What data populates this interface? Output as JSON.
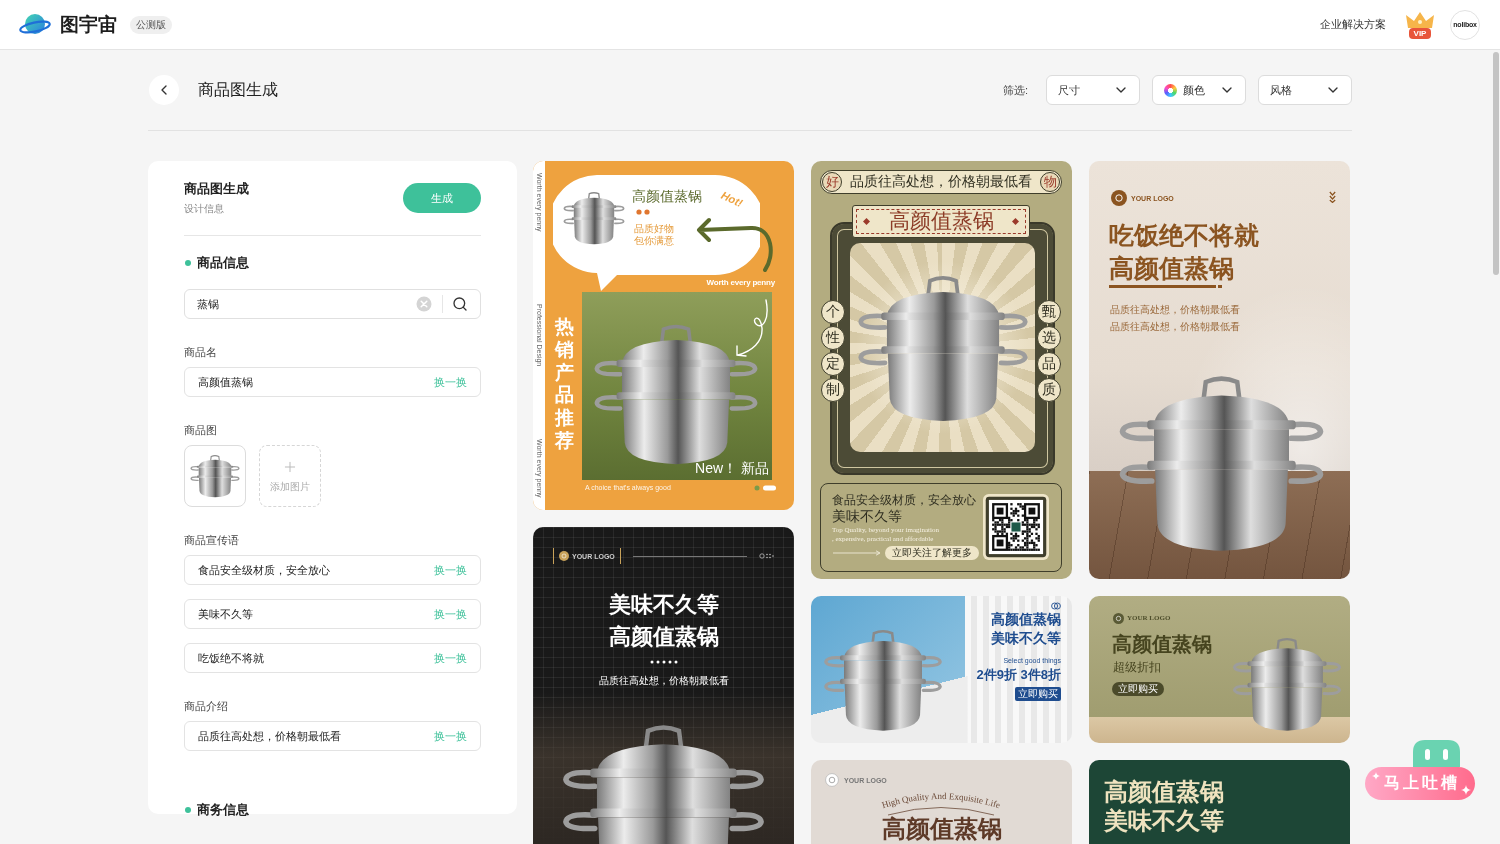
{
  "header": {
    "logo": "图宇宙",
    "badge": "公测版",
    "link": "企业解决方案",
    "vip": "VIP",
    "avatar": "nolibox"
  },
  "toolbar": {
    "title": "商品图生成",
    "filter_label": "筛选:",
    "filters": [
      {
        "kind": "plain",
        "label": "尺寸"
      },
      {
        "kind": "color",
        "label": "颜色"
      },
      {
        "kind": "plain",
        "label": "风格"
      }
    ]
  },
  "form": {
    "title": "商品图生成",
    "subtitle": "设计信息",
    "button": "生成",
    "sections": [
      {
        "title": "商品信息",
        "search": {
          "value": "蒸锅"
        },
        "groups": [
          {
            "kind": "text",
            "label": "商品名",
            "fields": [
              {
                "value": "高颜值蒸锅",
                "action": "换一换"
              }
            ]
          },
          {
            "kind": "images",
            "label": "商品图",
            "add_label": "添加图片"
          },
          {
            "kind": "text",
            "label": "商品宣传语",
            "fields": [
              {
                "value": "食品安全级材质，安全放心",
                "action": "换一换"
              },
              {
                "value": "美味不久等",
                "action": "换一换"
              },
              {
                "value": "吃饭绝不将就",
                "action": "换一换"
              }
            ]
          },
          {
            "kind": "text",
            "label": "商品介绍",
            "fields": [
              {
                "value": "品质往高处想，价格朝最低看",
                "action": "换一换"
              }
            ]
          }
        ]
      },
      {
        "title": "商务信息"
      }
    ]
  },
  "templates": {
    "columns": [
      [
        {
          "kind": "hot_sale",
          "side_texts": [
            "Worth every penny",
            "Professional Design",
            "Worth every penny"
          ],
          "title": "高颜值蒸锅",
          "hot": "Hot!",
          "tagline": [
            "品质好物",
            "包你满意"
          ],
          "slogan": "Worth every penny",
          "vertical_title": "热销产品推荐",
          "badge": "New！ 新品",
          "caption": "A choice that's always good"
        },
        {
          "kind": "dark_kitchen",
          "logo": "YOUR LOGO",
          "headline": [
            "美味不久等",
            "高颜值蒸锅"
          ],
          "subtitle": "品质往高处想，价格朝最低看"
        }
      ],
      [
        {
          "kind": "retro",
          "seals": [
            "好",
            "物"
          ],
          "banner": "品质往高处想，价格朝最低看",
          "title": "高颜值蒸锅",
          "left_badges": [
            "个",
            "性",
            "定",
            "制"
          ],
          "right_badges": [
            "甄",
            "选",
            "品",
            "质"
          ],
          "lines": [
            "食品安全级材质，安全放心",
            "美味不久等"
          ],
          "english": [
            "Top Quality, beyond your imagination",
            ", expensive, practical and affordable"
          ],
          "button": "立即关注了解更多"
        },
        {
          "kind": "blue_banner",
          "headline": [
            "高颜值蒸锅",
            "美味不久等"
          ],
          "caption": "Select good things",
          "offer": "2件9折 3件8折",
          "button": "立即购买"
        },
        {
          "kind": "beige_poster",
          "logo": "YOUR LOGO",
          "arc_text": "High Quality And Exquisite Life",
          "title": "高颜值蒸锅"
        }
      ],
      [
        {
          "kind": "kitchen_poster",
          "logo": "YOUR LOGO",
          "headline": [
            "吃饭绝不将就",
            "高颜值蒸锅"
          ],
          "lines": [
            "品质往高处想，价格朝最低看",
            "品质往高处想，价格朝最低看"
          ]
        },
        {
          "kind": "olive_banner",
          "logo": "YOUR LOGO",
          "title": "高颜值蒸锅",
          "subtitle": "超级折扣",
          "button": "立即购买"
        },
        {
          "kind": "green_poster",
          "headline": [
            "高颜值蒸锅",
            "美味不久等"
          ]
        }
      ]
    ]
  },
  "feedback_button": "马上吐槽"
}
